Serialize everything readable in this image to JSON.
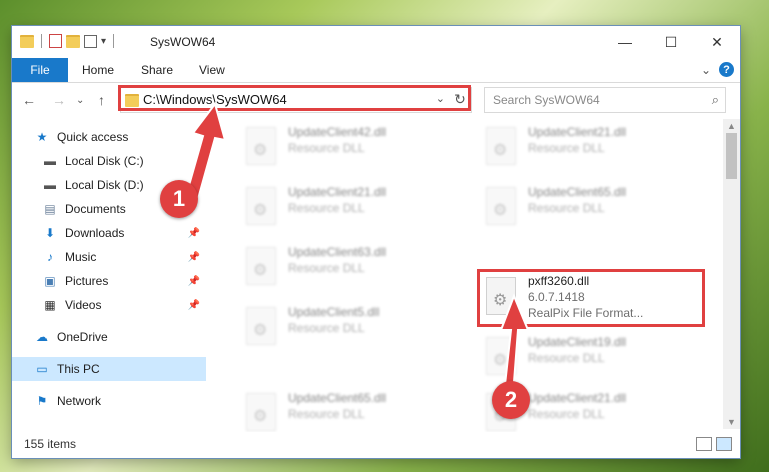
{
  "window": {
    "title": "SysWOW64",
    "controls": {
      "minimize": "—",
      "maximize": "☐",
      "close": "✕"
    }
  },
  "ribbon": {
    "tabs": [
      "File",
      "Home",
      "Share",
      "View"
    ],
    "expand_icon": "⌄",
    "help": "?"
  },
  "navbar": {
    "back": "←",
    "forward": "→",
    "recent": "⌄",
    "up": "↑",
    "address": "C:\\Windows\\SysWOW64",
    "address_dropdown": "⌄",
    "refresh": "↻",
    "search_placeholder": "Search SysWOW64",
    "search_icon": "⌕"
  },
  "sidebar": {
    "items": [
      {
        "label": "Quick access",
        "icon": "★"
      },
      {
        "label": "Local Disk (C:)",
        "icon": "▬"
      },
      {
        "label": "Local Disk (D:)",
        "icon": "▬"
      },
      {
        "label": "Documents",
        "icon": "▤"
      },
      {
        "label": "Downloads",
        "icon": "⬇"
      },
      {
        "label": "Music",
        "icon": "♪"
      },
      {
        "label": "Pictures",
        "icon": "▣"
      },
      {
        "label": "Videos",
        "icon": "▦"
      },
      {
        "label": "OneDrive",
        "icon": "☁"
      },
      {
        "label": "This PC",
        "icon": "▭"
      },
      {
        "label": "Network",
        "icon": "⚑"
      }
    ],
    "pin": "📌"
  },
  "files": [
    {
      "name": "UpdateClient42.dll",
      "desc": "Resource DLL"
    },
    {
      "name": "UpdateClient21.dll",
      "desc": "Resource DLL"
    },
    {
      "name": "UpdateClient21.dll",
      "desc": "Resource DLL"
    },
    {
      "name": "UpdateClient65.dll",
      "desc": "Resource DLL"
    },
    {
      "name": "UpdateClient63.dll",
      "desc": "Resource DLL"
    },
    {
      "name": "UpdateClient5.dll",
      "desc": "Resource DLL"
    },
    {
      "name": "UpdateClient19.dll",
      "desc": "Resource DLL"
    },
    {
      "name": "UpdateClient65.dll",
      "desc": "Resource DLL"
    },
    {
      "name": "UpdateClient21.dll",
      "desc": "Resource DLL"
    }
  ],
  "highlighted_file": {
    "name": "pxff3260.dll",
    "version": "6.0.7.1418",
    "desc": "RealPix File Format..."
  },
  "status": {
    "items": "155 items"
  },
  "annotations": {
    "step1": "1",
    "step2": "2",
    "color": "#e04040"
  }
}
